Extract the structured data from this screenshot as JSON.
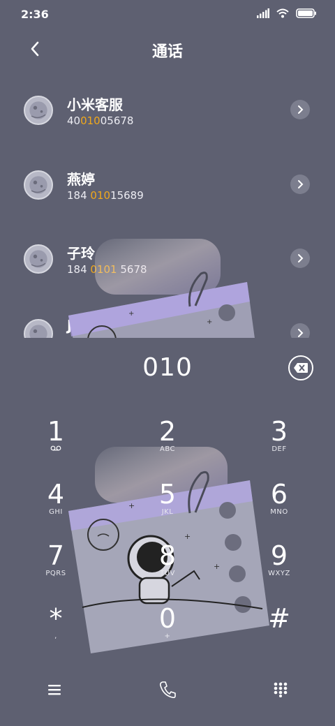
{
  "status_bar": {
    "time": "2:36"
  },
  "header": {
    "title": "通话"
  },
  "contacts": [
    {
      "name": "小米客服",
      "number_parts": [
        "40",
        "010",
        "05678"
      ]
    },
    {
      "name": "燕婷",
      "number_parts": [
        "184 ",
        "010",
        "15689"
      ]
    },
    {
      "name": "子玲",
      "number_parts": [
        "184 ",
        "0101",
        " 5678"
      ]
    },
    {
      "name": "Jason",
      "number_parts": [
        "",
        "",
        ""
      ]
    }
  ],
  "dialer": {
    "input_value": "010",
    "keys": [
      {
        "digit": "1",
        "letters": ""
      },
      {
        "digit": "2",
        "letters": "ABC"
      },
      {
        "digit": "3",
        "letters": "DEF"
      },
      {
        "digit": "4",
        "letters": "GHI"
      },
      {
        "digit": "5",
        "letters": "JKL"
      },
      {
        "digit": "6",
        "letters": "MNO"
      },
      {
        "digit": "7",
        "letters": "PQRS"
      },
      {
        "digit": "8",
        "letters": "TUV"
      },
      {
        "digit": "9",
        "letters": "WXYZ"
      },
      {
        "digit": "*",
        "letters": ","
      },
      {
        "digit": "0",
        "letters": "+"
      },
      {
        "digit": "#",
        "letters": ""
      }
    ]
  },
  "icons": {
    "back": "chevron-left-icon",
    "backspace": "backspace-icon",
    "menu": "menu-icon",
    "call": "phone-icon",
    "keypad": "keypad-icon",
    "voicemail": "voicemail-icon"
  },
  "colors": {
    "background": "#5e6071",
    "highlight": "#f0a81c"
  }
}
